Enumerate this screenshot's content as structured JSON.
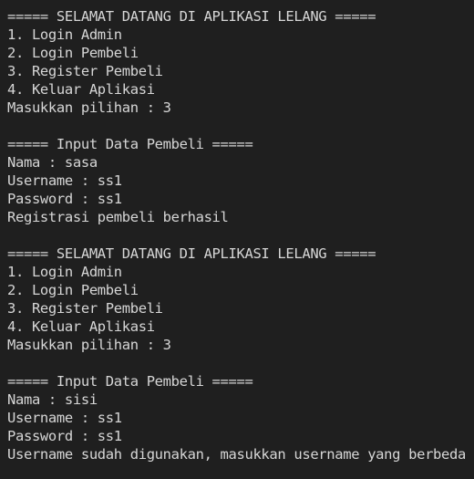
{
  "terminal": {
    "background": "#1f1f1f",
    "foreground": "#d6d6d6",
    "lines": [
      "===== SELAMAT DATANG DI APLIKASI LELANG =====",
      "1. Login Admin",
      "2. Login Pembeli",
      "3. Register Pembeli",
      "4. Keluar Aplikasi",
      "Masukkan pilihan : 3",
      "",
      "===== Input Data Pembeli =====",
      "Nama : sasa",
      "Username : ss1",
      "Password : ss1",
      "Registrasi pembeli berhasil",
      "",
      "===== SELAMAT DATANG DI APLIKASI LELANG =====",
      "1. Login Admin",
      "2. Login Pembeli",
      "3. Register Pembeli",
      "4. Keluar Aplikasi",
      "Masukkan pilihan : 3",
      "",
      "===== Input Data Pembeli =====",
      "Nama : sisi",
      "Username : ss1",
      "Password : ss1",
      "Username sudah digunakan, masukkan username yang berbeda"
    ]
  }
}
